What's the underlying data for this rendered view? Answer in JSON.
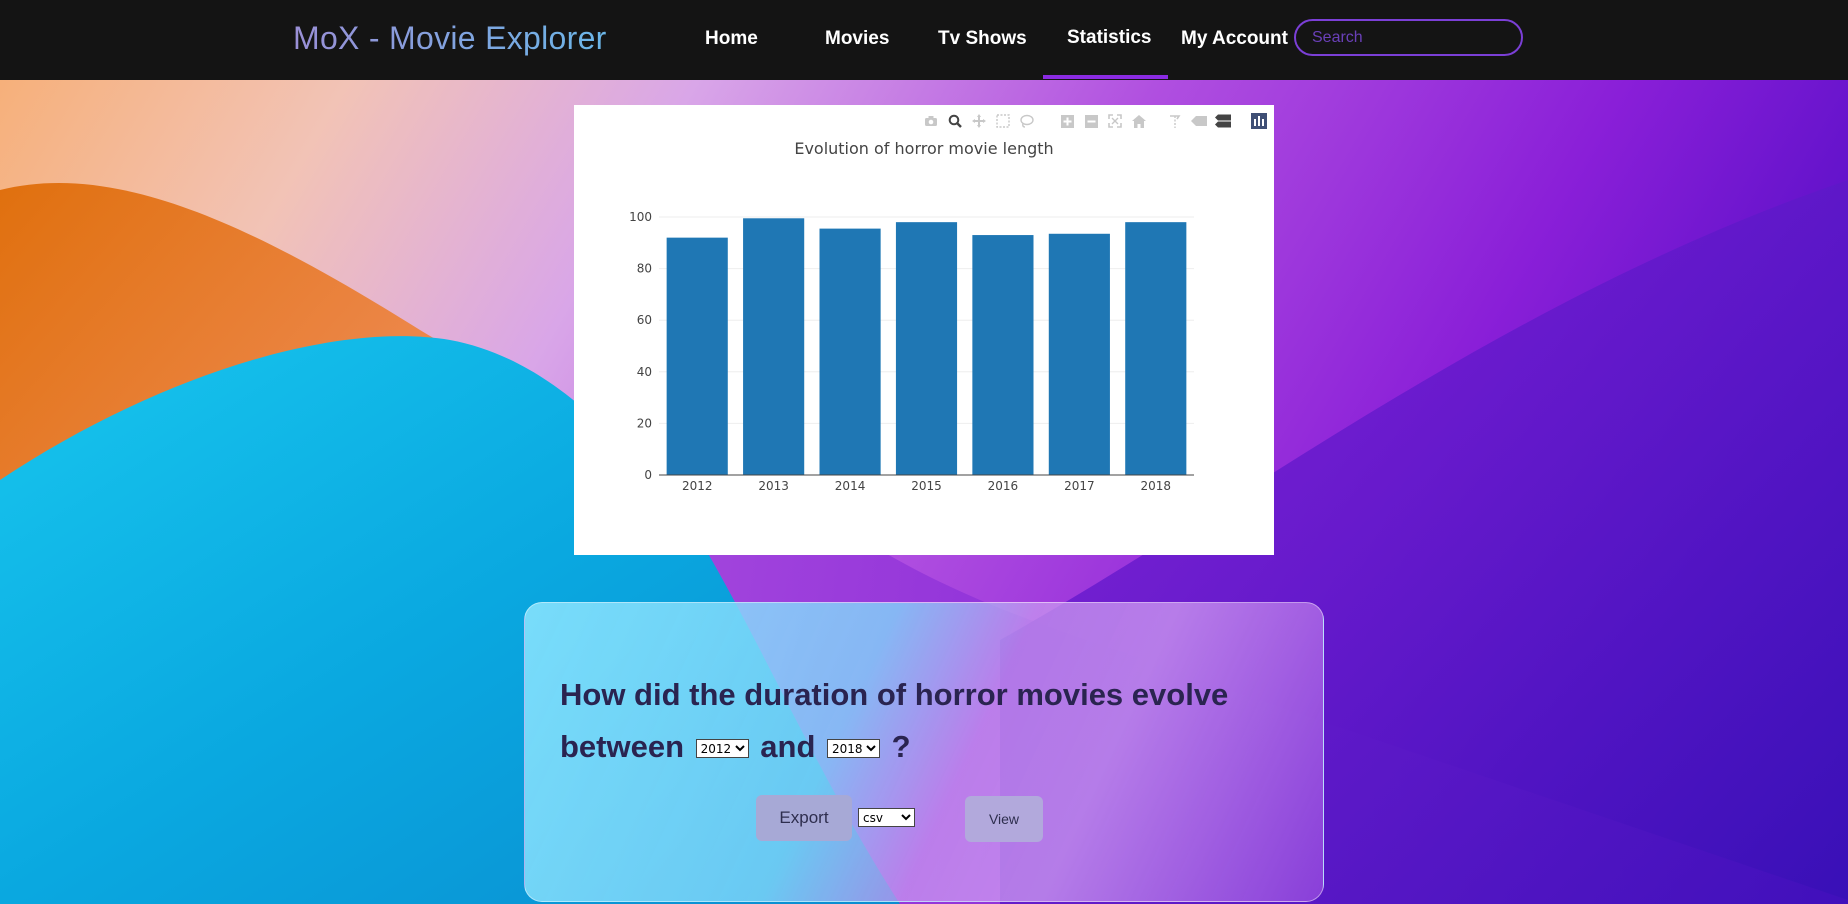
{
  "nav": {
    "brand": "MoX - Movie Explorer",
    "items": [
      {
        "label": "Home"
      },
      {
        "label": "Movies"
      },
      {
        "label": "Tv Shows"
      },
      {
        "label": "Statistics"
      },
      {
        "label": "My Account"
      }
    ],
    "active": "Statistics",
    "search_placeholder": "Search"
  },
  "colors": {
    "navbar_bg": "#141414",
    "accent": "#8a2be2",
    "bar_color": "#1f77b4",
    "question_text": "#2a2450"
  },
  "modebar_icons": [
    "camera-icon",
    "zoom-icon",
    "pan-icon",
    "box-select-icon",
    "lasso-select-icon",
    "zoom-in-icon",
    "zoom-out-icon",
    "autoscale-icon",
    "reset-axes-icon",
    "spike-lines-icon",
    "hover-closest-icon",
    "hover-compare-icon",
    "plotly-logo-icon"
  ],
  "chart_data": {
    "type": "bar",
    "title": "Evolution of horror movie length",
    "xlabel": "",
    "ylabel": "",
    "categories": [
      "2012",
      "2013",
      "2014",
      "2015",
      "2016",
      "2017",
      "2018"
    ],
    "values": [
      92,
      99.5,
      95.5,
      98,
      93,
      93.5,
      98
    ],
    "ylim": [
      0,
      100
    ],
    "yticks": [
      0,
      20,
      40,
      60,
      80,
      100
    ],
    "grid": true,
    "legend": "none"
  },
  "question": {
    "text_before": "How did the duration of horror movies evolve between",
    "text_middle": "and",
    "text_end": "?",
    "start_year": "2012",
    "end_year": "2018"
  },
  "actions": {
    "export_label": "Export",
    "format_value": "csv",
    "view_label": "View"
  }
}
